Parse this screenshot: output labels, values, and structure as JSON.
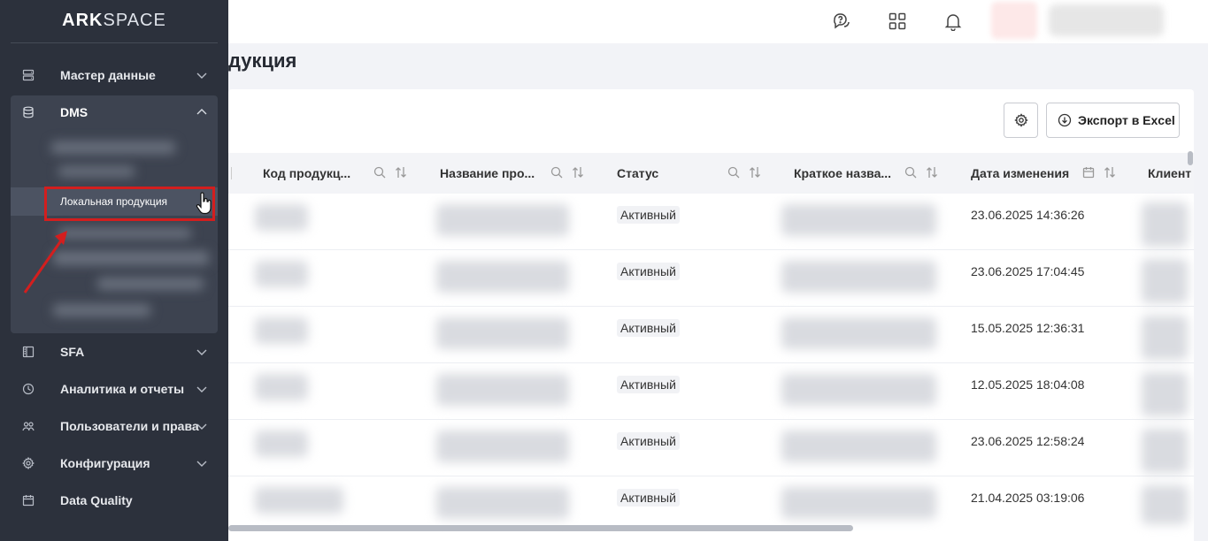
{
  "header": {
    "icons": [
      "support-chat-icon",
      "apps-grid-icon",
      "bell-icon"
    ]
  },
  "page": {
    "title": "дукция"
  },
  "toolbar": {
    "export_label": "Экспорт в Excel"
  },
  "table": {
    "columns": [
      {
        "label": "Код продукц..."
      },
      {
        "label": "Название про..."
      },
      {
        "label": "Статус"
      },
      {
        "label": "Краткое назва..."
      },
      {
        "label": "Дата изменения"
      },
      {
        "label": "Клиент"
      }
    ],
    "rows": [
      {
        "status": "Активный",
        "date": "23.06.2025 14:36:26"
      },
      {
        "status": "Активный",
        "date": "23.06.2025 17:04:45"
      },
      {
        "status": "Активный",
        "date": "15.05.2025 12:36:31"
      },
      {
        "status": "Активный",
        "date": "12.05.2025 18:04:08"
      },
      {
        "status": "Активный",
        "date": "23.06.2025 12:58:24"
      },
      {
        "status": "Активный",
        "date": "21.04.2025 03:19:06"
      }
    ]
  },
  "sidebar": {
    "logo_ark": "ARK",
    "logo_space": "SPACE",
    "items": [
      {
        "label": "Мастер данные"
      },
      {
        "label": "DMS"
      },
      {
        "label": "SFA"
      },
      {
        "label": "Аналитика и отчеты"
      },
      {
        "label": "Пользователи и права"
      },
      {
        "label": "Конфигурация"
      },
      {
        "label": "Data Quality"
      }
    ],
    "dms_active_sub": "Локальная продукция"
  },
  "colors": {
    "sidebar_bg": "#2c313c",
    "highlight": "#d31e1e",
    "page_bg": "#f2f3f7"
  }
}
